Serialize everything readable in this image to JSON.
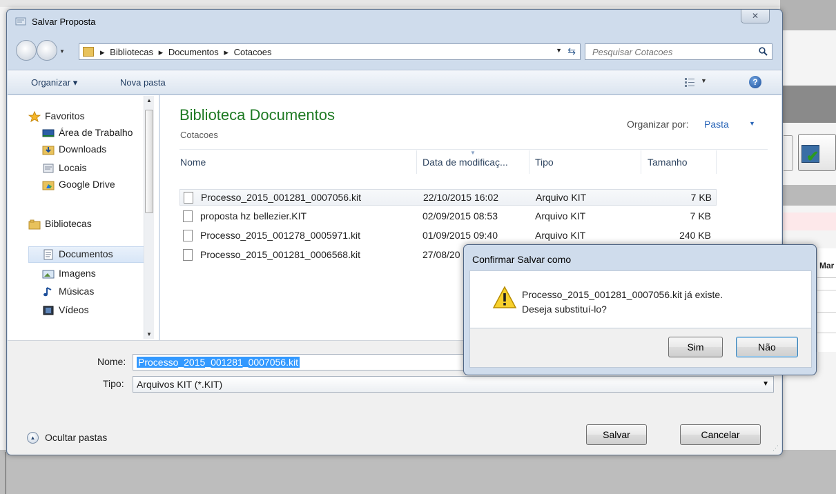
{
  "dialog": {
    "title": "Salvar Proposta",
    "close_glyph": "✕",
    "breadcrumb": [
      "Bibliotecas",
      "Documentos",
      "Cotacoes"
    ],
    "search_placeholder": "Pesquisar Cotacoes",
    "toolbar": {
      "organize": "Organizar ▾",
      "new_folder": "Nova pasta"
    },
    "nav": {
      "items": [
        {
          "label": "Favoritos",
          "icon": "star-icon"
        },
        {
          "label": "Área de Trabalho",
          "icon": "desktop-icon"
        },
        {
          "label": "Downloads",
          "icon": "downloads-folder-icon"
        },
        {
          "label": "Locais",
          "icon": "recent-places-icon"
        },
        {
          "label": "Google Drive",
          "icon": "google-drive-icon"
        },
        {
          "label": "Bibliotecas",
          "icon": "libraries-icon"
        },
        {
          "label": "Documentos",
          "icon": "documents-icon",
          "selected": true
        },
        {
          "label": "Imagens",
          "icon": "pictures-icon"
        },
        {
          "label": "Músicas",
          "icon": "music-icon"
        },
        {
          "label": "Vídeos",
          "icon": "videos-icon"
        }
      ]
    },
    "content": {
      "library_title": "Biblioteca Documentos",
      "library_subtitle": "Cotacoes",
      "arrange_label": "Organizar por:",
      "arrange_value": "Pasta",
      "columns": [
        "Nome",
        "Data de modificaç...",
        "Tipo",
        "Tamanho"
      ],
      "files": [
        {
          "name": "Processo_2015_001281_0007056.kit",
          "date": "22/10/2015 16:02",
          "type": "Arquivo KIT",
          "size": "7 KB"
        },
        {
          "name": "proposta hz bellezier.KIT",
          "date": "02/09/2015 08:53",
          "type": "Arquivo KIT",
          "size": "7 KB"
        },
        {
          "name": "Processo_2015_001278_0005971.kit",
          "date": "01/09/2015 09:40",
          "type": "Arquivo KIT",
          "size": "240 KB"
        },
        {
          "name": "Processo_2015_001281_0006568.kit",
          "date": "27/08/20",
          "type": "",
          "size": ""
        }
      ]
    },
    "filename_label": "Nome:",
    "filename_value": "Processo_2015_001281_0007056.kit",
    "filetype_label": "Tipo:",
    "filetype_value": "Arquivos KIT (*.KIT)",
    "hide_folders": "Ocultar pastas",
    "save_button": "Salvar",
    "cancel_button": "Cancelar"
  },
  "confirm": {
    "title": "Confirmar Salvar como",
    "message_line1": "Processo_2015_001281_0007056.kit já existe.",
    "message_line2": "Deseja substituí-lo?",
    "yes_button": "Sim",
    "no_button": "Não"
  },
  "background_app": {
    "column_header": "Mar"
  }
}
